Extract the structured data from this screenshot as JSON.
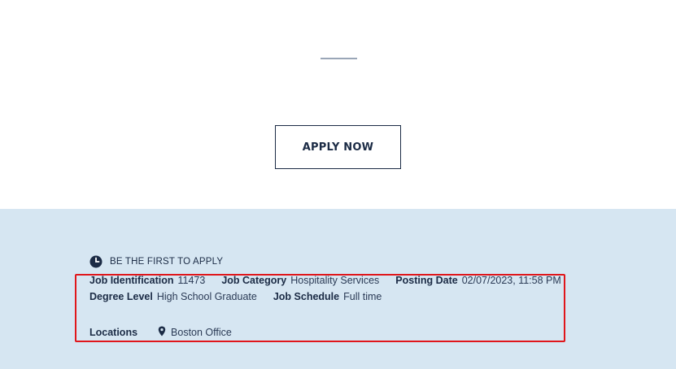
{
  "apply": {
    "label": "APPLY NOW"
  },
  "banner": {
    "label": "BE THE FIRST TO APPLY",
    "icon": "clock-icon"
  },
  "details": {
    "job_id_label": "Job Identification",
    "job_id": "11473",
    "category_label": "Job Category",
    "category": "Hospitality Services",
    "posting_date_label": "Posting Date",
    "posting_date": "02/07/2023, 11:58 PM",
    "degree_label": "Degree Level",
    "degree": "High School Graduate",
    "schedule_label": "Job Schedule",
    "schedule": "Full time",
    "locations_label": "Locations",
    "location": "Boston Office",
    "location_icon": "map-pin-icon"
  },
  "colors": {
    "navy": "#1b2b45",
    "panel_bg": "#d6e6f2",
    "highlight": "#e0161b"
  }
}
